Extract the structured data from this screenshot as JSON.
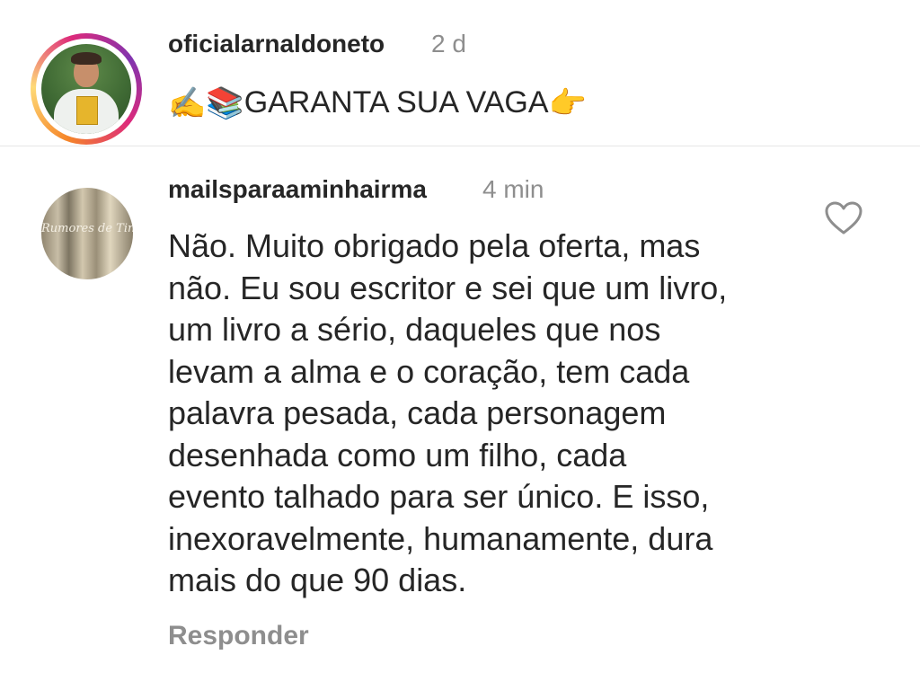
{
  "post": {
    "username": "oficialarnaldoneto",
    "time": "2 d",
    "caption": {
      "emoji_1": "✍️",
      "emoji_2": "📚",
      "text": "GARANTA SUA VAGA",
      "emoji_3": "👉"
    },
    "avatar": "avatar-with-story-ring"
  },
  "comment": {
    "username": "mailsparaaminhairma",
    "time": "4 min",
    "avatar_text": "Rumores de Tinta",
    "body_lines": [
      "Não. Muito obrigado pela oferta,  mas",
      "não. Eu sou escritor e sei que um livro,",
      "um livro a sério, daqueles que nos",
      "levam a alma e o coração, tem cada",
      "palavra pesada, cada personagem",
      "desenhada como um filho, cada",
      "evento talhado para ser único. E isso,",
      "inexoravelmente, humanamente, dura",
      "mais do que 90 dias."
    ],
    "reply_label": "Responder",
    "like_icon": "heart-outline-icon"
  },
  "colors": {
    "text_primary": "#262626",
    "text_secondary": "#8e8e8e",
    "divider": "#e6e6e6",
    "story_ring": [
      "#f58529",
      "#feda77",
      "#dd2a7b",
      "#8134af"
    ]
  }
}
